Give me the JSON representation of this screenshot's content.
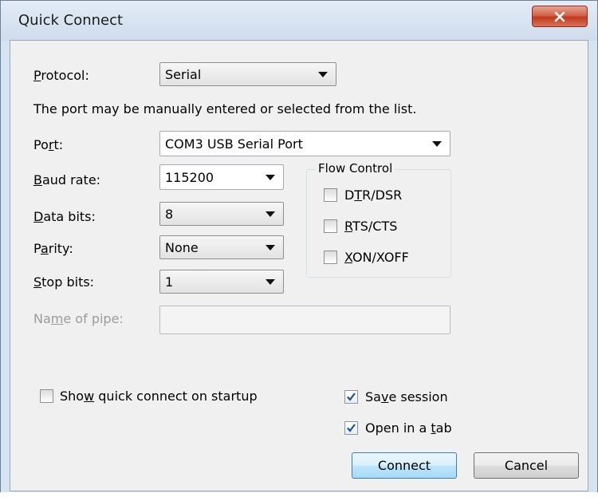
{
  "window": {
    "title": "Quick Connect",
    "close_glyph": "✕"
  },
  "protocol": {
    "label_pre": "",
    "label_u": "P",
    "label_post": "rotocol:",
    "value": "Serial"
  },
  "port_hint": "The port may be manually entered or selected from the list.",
  "port": {
    "label_pre": "Po",
    "label_u": "r",
    "label_post": "t:",
    "value": "COM3 USB Serial Port"
  },
  "baud_rate": {
    "label_pre": "",
    "label_u": "B",
    "label_post": "aud rate:",
    "value": "115200"
  },
  "data_bits": {
    "label_pre": "",
    "label_u": "D",
    "label_post": "ata bits:",
    "value": "8"
  },
  "parity": {
    "label_pre": "P",
    "label_u": "a",
    "label_post": "rity:",
    "value": "None"
  },
  "stop_bits": {
    "label_pre": "",
    "label_u": "S",
    "label_post": "top bits:",
    "value": "1"
  },
  "name_of_pipe": {
    "label_pre": "Na",
    "label_u": "m",
    "label_post": "e of pipe:",
    "value": ""
  },
  "flow_control": {
    "title": "Flow Control",
    "dtr": {
      "pre": "D",
      "u": "T",
      "post": "R/DSR",
      "checked": false
    },
    "rts": {
      "pre": "",
      "u": "R",
      "post": "TS/CTS",
      "checked": false
    },
    "xon": {
      "pre": "",
      "u": "X",
      "post": "ON/XOFF",
      "checked": false
    }
  },
  "options": {
    "show_quick": {
      "pre": "Sho",
      "u": "w",
      "post": " quick connect on startup",
      "checked": false
    },
    "save_session": {
      "pre": "Sa",
      "u": "v",
      "post": "e session",
      "checked": true
    },
    "open_tab": {
      "pre": "Open in a ",
      "u": "t",
      "post": "ab",
      "checked": true
    }
  },
  "buttons": {
    "connect": "Connect",
    "cancel": "Cancel"
  },
  "colors": {
    "accent": "#3c7fb1",
    "close_red": "#c2391e",
    "check_blue": "#1f4f9a"
  }
}
